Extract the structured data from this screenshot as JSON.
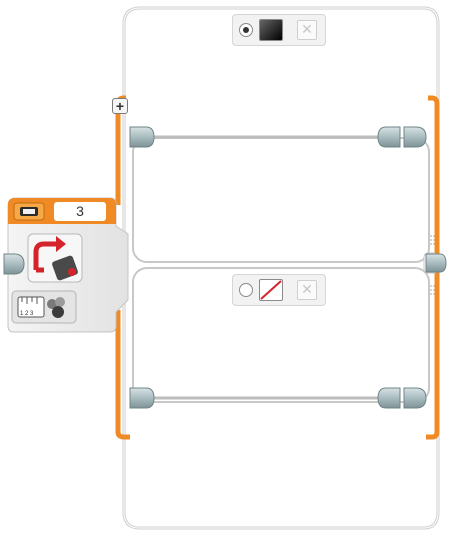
{
  "switch_block": {
    "port_value": "3",
    "mode_icon": "color-sensor-compare-icon",
    "measure_icon": "color-palette-icon"
  },
  "cases": [
    {
      "selected": true,
      "value_icon": "black-color-swatch-icon",
      "delete_icon": "close-icon"
    },
    {
      "selected": false,
      "value_icon": "no-color-swatch-icon",
      "delete_icon": "close-icon"
    }
  ],
  "add_case_label": "+",
  "colors": {
    "accent": "#f08a24",
    "wire": "#bdbdbd",
    "frame": "#c9c9c9"
  }
}
